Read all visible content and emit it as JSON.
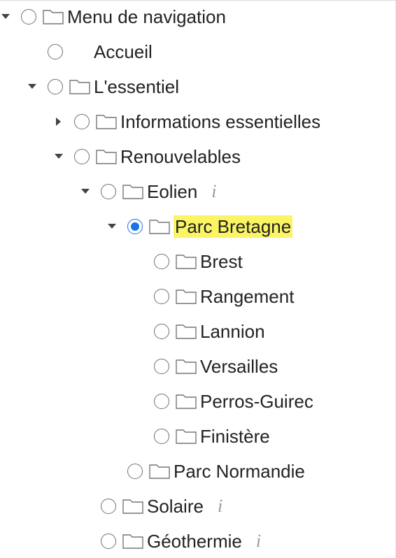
{
  "tree": {
    "nodes": [
      {
        "label": "Menu de navigation",
        "toggle": "expanded",
        "checked": false,
        "folder": true,
        "info": false,
        "highlight": false
      },
      {
        "label": "Accueil",
        "toggle": "none",
        "checked": false,
        "folder": false,
        "info": false,
        "highlight": false
      },
      {
        "label": "L'essentiel",
        "toggle": "expanded",
        "checked": false,
        "folder": true,
        "info": false,
        "highlight": false
      },
      {
        "label": "Informations essentielles",
        "toggle": "collapsed",
        "checked": false,
        "folder": true,
        "info": false,
        "highlight": false
      },
      {
        "label": "Renouvelables",
        "toggle": "expanded",
        "checked": false,
        "folder": true,
        "info": false,
        "highlight": false
      },
      {
        "label": "Eolien",
        "toggle": "expanded",
        "checked": false,
        "folder": true,
        "info": true,
        "highlight": false
      },
      {
        "label": "Parc Bretagne",
        "toggle": "expanded",
        "checked": true,
        "folder": true,
        "info": false,
        "highlight": true
      },
      {
        "label": "Brest",
        "toggle": "none",
        "checked": false,
        "folder": true,
        "info": false,
        "highlight": false
      },
      {
        "label": "Rangement",
        "toggle": "none",
        "checked": false,
        "folder": true,
        "info": false,
        "highlight": false
      },
      {
        "label": "Lannion",
        "toggle": "none",
        "checked": false,
        "folder": true,
        "info": false,
        "highlight": false
      },
      {
        "label": "Versailles",
        "toggle": "none",
        "checked": false,
        "folder": true,
        "info": false,
        "highlight": false
      },
      {
        "label": "Perros-Guirec",
        "toggle": "none",
        "checked": false,
        "folder": true,
        "info": false,
        "highlight": false
      },
      {
        "label": "Finistère",
        "toggle": "none",
        "checked": false,
        "folder": true,
        "info": false,
        "highlight": false
      },
      {
        "label": "Parc Normandie",
        "toggle": "none",
        "checked": false,
        "folder": true,
        "info": false,
        "highlight": false
      },
      {
        "label": "Solaire",
        "toggle": "none",
        "checked": false,
        "folder": true,
        "info": true,
        "highlight": false
      },
      {
        "label": "Géothermie",
        "toggle": "none",
        "checked": false,
        "folder": true,
        "info": true,
        "highlight": false
      }
    ],
    "info_glyph": "i"
  },
  "icons": {
    "toggle_expanded": "caret-down-icon",
    "toggle_collapsed": "caret-right-icon",
    "folder": "folder-icon",
    "info": "info-icon"
  },
  "colors": {
    "radio_selected": "#1a73e8",
    "highlight": "#fbf463",
    "info_icon": "#9a9a9a",
    "text": "#222222"
  }
}
